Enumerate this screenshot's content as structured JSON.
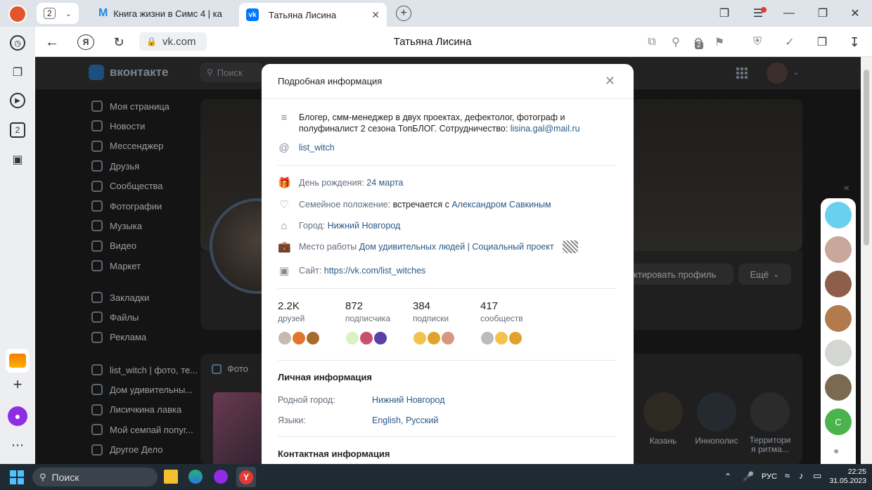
{
  "browser": {
    "tab_count": "2",
    "tabs": [
      {
        "label": "Книга жизни в Симс 4 | ка"
      },
      {
        "label": "Татьяна Лисина"
      }
    ],
    "address": "vk.com",
    "page_title": "Татьяна Лисина",
    "extension_badge": "2"
  },
  "vk": {
    "logo": "вконтакте",
    "search_placeholder": "Поиск",
    "sidebar": [
      {
        "label": "Моя страница",
        "icon": "user-circle-icon"
      },
      {
        "label": "Новости",
        "icon": "news-icon"
      },
      {
        "label": "Мессенджер",
        "icon": "chat-icon"
      },
      {
        "label": "Друзья",
        "icon": "friends-icon"
      },
      {
        "label": "Сообщества",
        "icon": "groups-icon"
      },
      {
        "label": "Фотографии",
        "icon": "photo-icon"
      },
      {
        "label": "Музыка",
        "icon": "music-icon"
      },
      {
        "label": "Видео",
        "icon": "video-icon"
      },
      {
        "label": "Маркет",
        "icon": "market-icon"
      }
    ],
    "sidebar2": [
      {
        "label": "Закладки"
      },
      {
        "label": "Файлы"
      },
      {
        "label": "Реклама"
      }
    ],
    "sidebar3": [
      {
        "label": "list_witch | фото, те..."
      },
      {
        "label": "Дом удивительны..."
      },
      {
        "label": "Лисичкина лавка"
      },
      {
        "label": "Мой семпай попуг..."
      },
      {
        "label": "Другое Дело"
      }
    ],
    "edit_profile": "ктировать профиль",
    "more": "Ещё",
    "photos_tab": "Фото",
    "communities": [
      {
        "label": "Казань"
      },
      {
        "label": "Иннополис"
      },
      {
        "label": "Территори я ритма..."
      }
    ]
  },
  "modal": {
    "title": "Подробная информация",
    "bio": "Блогер, смм-менеджер в двух проектах, дефектолог, фотограф и полуфиналист 2 сезона ТопБЛОГ. Сотрудничество: ",
    "bio_email": "lisina.gal@mail.ru",
    "nickname": "list_witch",
    "birthday_label": "День рождения: ",
    "birthday": "24 марта",
    "family_label": "Семейное положение: ",
    "family_text": "встречается с ",
    "family_partner": "Александром Савкиным",
    "city_label": "Город: ",
    "city": "Нижний Новгород",
    "work_label": "Место работы ",
    "work": "Дом удивительных людей | Социальный проект",
    "site_label": "Сайт: ",
    "site": "https://vk.com/list_witches",
    "stats": [
      {
        "n": "2.2K",
        "t": "друзей"
      },
      {
        "n": "872",
        "t": "подписчика"
      },
      {
        "n": "384",
        "t": "подписки"
      },
      {
        "n": "417",
        "t": "сообществ"
      }
    ],
    "personal_title": "Личная информация",
    "hometown_label": "Родной город:",
    "hometown": "Нижний Новгород",
    "languages_label": "Языки:",
    "languages": "English, Русский",
    "contacts_title": "Контактная информация"
  },
  "taskbar": {
    "search": "Поиск",
    "lang": "РУС",
    "time": "22:25",
    "date": "31.05.2023"
  }
}
